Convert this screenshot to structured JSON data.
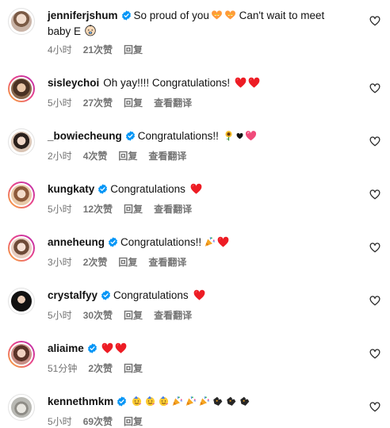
{
  "comments": [
    {
      "username": "jenniferjshum",
      "verified": true,
      "text": "So proud of you",
      "text2": " Can't wait to meet",
      "text_line2": "baby E",
      "time": "4小时",
      "likes": "21次赞",
      "reply": "回复",
      "translate": "",
      "avatar_color": "#c9b3a6"
    },
    {
      "username": "sisleychoi",
      "verified": false,
      "text": "Oh yay!!!! Congratulations!",
      "time": "5小时",
      "likes": "27次赞",
      "reply": "回复",
      "translate": "查看翻译",
      "avatar_color": "#8a6a4e"
    },
    {
      "username": "_bowiecheung",
      "verified": true,
      "text": "Congratulations!!",
      "time": "2小时",
      "likes": "4次赞",
      "reply": "回复",
      "translate": "查看翻译",
      "avatar_color": "#d9c4b4"
    },
    {
      "username": "kungkaty",
      "verified": true,
      "text": "Congratulations",
      "time": "5小时",
      "likes": "12次赞",
      "reply": "回复",
      "translate": "查看翻译",
      "avatar_color": "#e8c9a8"
    },
    {
      "username": "anneheung",
      "verified": true,
      "text": "Congratulations!!",
      "time": "3小时",
      "likes": "2次赞",
      "reply": "回复",
      "translate": "查看翻译",
      "avatar_color": "#e7cdbf"
    },
    {
      "username": "crystalfyy",
      "verified": true,
      "text": "Congratulations",
      "time": "5小时",
      "likes": "30次赞",
      "reply": "回复",
      "translate": "查看翻译",
      "avatar_color": "#2a2422"
    },
    {
      "username": "aliaime",
      "verified": true,
      "text": "",
      "time": "51分钟",
      "likes": "2次赞",
      "reply": "回复",
      "translate": "",
      "avatar_color": "#c98f86"
    },
    {
      "username": "kennethmkm",
      "verified": true,
      "text": "",
      "time": "5小时",
      "likes": "69次赞",
      "reply": "回复",
      "translate": "",
      "avatar_color": "#b9b9b4"
    }
  ],
  "colors": {
    "verified": "#0095f6",
    "heart": "#ed1c24",
    "meta": "#737373"
  },
  "icons": {
    "like": "heart-outline-icon",
    "verified": "verified-badge-icon"
  }
}
